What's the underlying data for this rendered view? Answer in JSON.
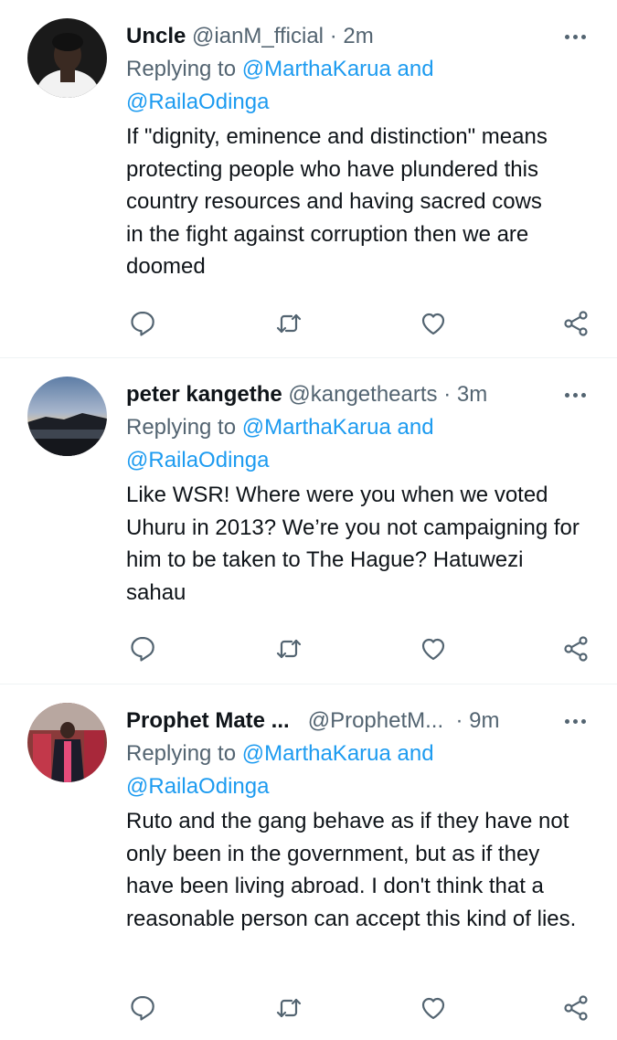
{
  "tweets": [
    {
      "name": "Uncle",
      "handle": "@ianM_fficial",
      "separator": "·",
      "time": "2m",
      "replying_prefix": "Replying to",
      "mention1": "@MarthaKarua",
      "and": "and",
      "mention2": "@RailaOdinga",
      "text": "If \"dignity, eminence and distinction\" means protecting people who have plundered this country resources and having sacred cows in the fight against corruption then we are doomed"
    },
    {
      "name": "peter kangethe",
      "handle": "@kangethearts",
      "separator": "·",
      "time": "3m",
      "replying_prefix": "Replying to",
      "mention1": "@MarthaKarua",
      "and": "and",
      "mention2": "@RailaOdinga",
      "text": "Like WSR! Where were you when we voted Uhuru in 2013? We’re you not campaigning for him to be taken to The Hague? Hatuwezi sahau"
    },
    {
      "name": "Prophet Mate ...",
      "handle": "@ProphetM...",
      "separator": "·",
      "time": "9m",
      "replying_prefix": "Replying to",
      "mention1": "@MarthaKarua",
      "and": "and",
      "mention2": "@RailaOdinga",
      "text": "Ruto and the gang behave as if they have not only been in the government, but as if they have been living abroad. I don't think that a reasonable person can accept this kind of lies."
    }
  ],
  "colors": {
    "link": "#1d9bf0",
    "secondary_text": "#536471",
    "primary_text": "#0f1419",
    "divider": "#eff3f4"
  },
  "icons": {
    "reply": "speech-bubble-icon",
    "retweet": "retweet-icon",
    "like": "heart-icon",
    "share": "share-icon",
    "more": "more-dots-icon"
  }
}
